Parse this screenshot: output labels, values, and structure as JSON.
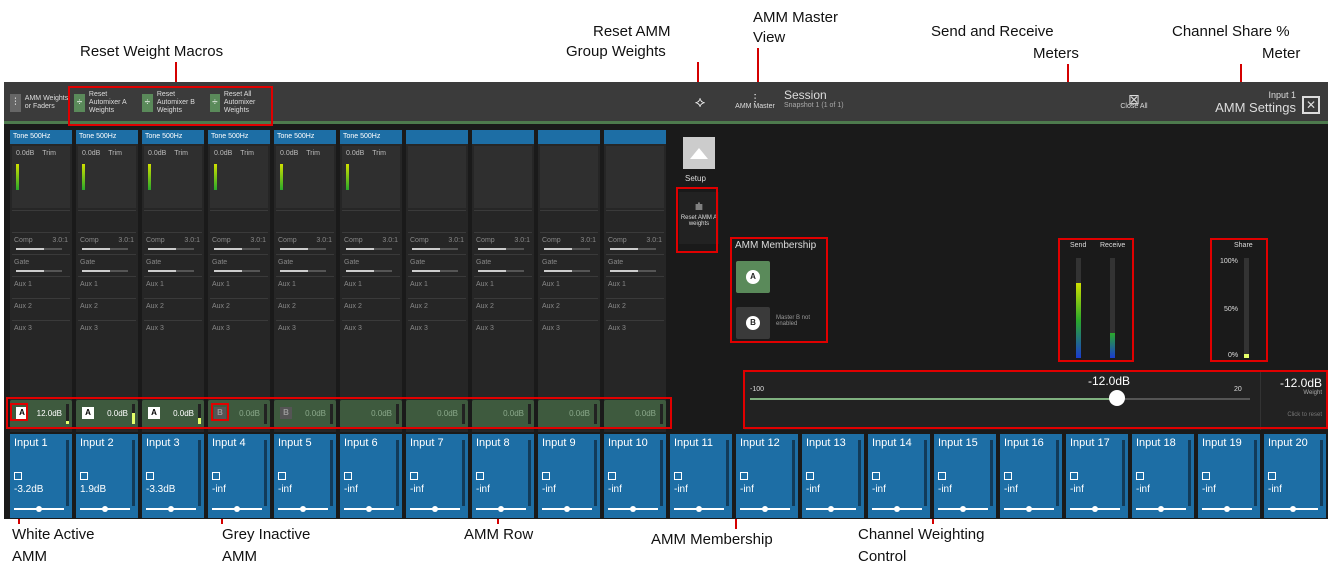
{
  "callouts": {
    "reset_weight_macros": "Reset Weight Macros",
    "reset_amm_group_1": "Reset AMM",
    "reset_amm_group_2": "Group Weights",
    "amm_master_view_1": "AMM Master",
    "amm_master_view_2": "View",
    "send_receive_1": "Send and Receive",
    "send_receive_2": "Meters",
    "share_1": "Channel Share %",
    "share_2": "Meter",
    "white_active_1": "White Active",
    "white_active_2": "AMM",
    "grey_inactive_1": "Grey Inactive",
    "grey_inactive_2": "AMM",
    "amm_row": "AMM Row",
    "amm_membership": "AMM Membership",
    "channel_weighting_1": "Channel Weighting",
    "channel_weighting_2": "Control"
  },
  "topbar": {
    "amm_weights_btn": "AMM Weights or Faders",
    "reset_a": "Reset Automixer A Weights",
    "reset_b": "Reset Automixer B Weights",
    "reset_all": "Reset All Automixer Weights",
    "amm_master": "AMM Master",
    "session_title": "Session",
    "session_snapshot": "Snapshot 1 (1 of 1)",
    "close_all": "Close All",
    "settings_line1": "Input 1",
    "settings_line2": "AMM Settings"
  },
  "strips": [
    {
      "tone": "Tone 500Hz",
      "gain": "0.0dB",
      "trim": "Trim",
      "comp": "Comp",
      "ratio": "3.0:1",
      "gate": "Gate",
      "aux1": "Aux 1",
      "aux2": "Aux 2",
      "aux3": "Aux 3",
      "amm_badge": "A",
      "amm_val": "12.0dB",
      "amm_active": true,
      "amm_level": 0.15,
      "input": "Input 1",
      "input_gain": "-3.2dB"
    },
    {
      "tone": "Tone 500Hz",
      "gain": "0.0dB",
      "trim": "Trim",
      "comp": "Comp",
      "ratio": "3.0:1",
      "gate": "Gate",
      "aux1": "Aux 1",
      "aux2": "Aux 2",
      "aux3": "Aux 3",
      "amm_badge": "A",
      "amm_val": "0.0dB",
      "amm_active": true,
      "amm_level": 0.55,
      "input": "Input 2",
      "input_gain": "1.9dB"
    },
    {
      "tone": "Tone 500Hz",
      "gain": "0.0dB",
      "trim": "Trim",
      "comp": "Comp",
      "ratio": "3.0:1",
      "gate": "Gate",
      "aux1": "Aux 1",
      "aux2": "Aux 2",
      "aux3": "Aux 3",
      "amm_badge": "A",
      "amm_val": "0.0dB",
      "amm_active": true,
      "amm_level": 0.3,
      "input": "Input 3",
      "input_gain": "-3.3dB"
    },
    {
      "tone": "Tone 500Hz",
      "gain": "0.0dB",
      "trim": "Trim",
      "comp": "Comp",
      "ratio": "3.0:1",
      "gate": "Gate",
      "aux1": "Aux 1",
      "aux2": "Aux 2",
      "aux3": "Aux 3",
      "amm_badge": "B",
      "amm_val": "0.0dB",
      "amm_active": false,
      "amm_level": 0,
      "input": "Input 4",
      "input_gain": "-inf"
    },
    {
      "tone": "Tone 500Hz",
      "gain": "0.0dB",
      "trim": "Trim",
      "comp": "Comp",
      "ratio": "3.0:1",
      "gate": "Gate",
      "aux1": "Aux 1",
      "aux2": "Aux 2",
      "aux3": "Aux 3",
      "amm_badge": "B",
      "amm_val": "0.0dB",
      "amm_active": false,
      "amm_level": 0,
      "input": "Input 5",
      "input_gain": "-inf"
    },
    {
      "tone": "Tone 500Hz",
      "gain": "0.0dB",
      "trim": "Trim",
      "comp": "Comp",
      "ratio": "3.0:1",
      "gate": "Gate",
      "aux1": "Aux 1",
      "aux2": "Aux 2",
      "aux3": "Aux 3",
      "amm_badge": "",
      "amm_val": "0.0dB",
      "amm_active": false,
      "amm_level": 0,
      "input": "Input 6",
      "input_gain": "-inf"
    },
    {
      "tone": "",
      "gain": "",
      "trim": "",
      "comp": "Comp",
      "ratio": "3.0:1",
      "gate": "Gate",
      "aux1": "Aux 1",
      "aux2": "Aux 2",
      "aux3": "Aux 3",
      "amm_badge": "",
      "amm_val": "0.0dB",
      "amm_active": false,
      "amm_level": 0,
      "input": "Input 7",
      "input_gain": "-inf"
    },
    {
      "tone": "",
      "gain": "",
      "trim": "",
      "comp": "Comp",
      "ratio": "3.0:1",
      "gate": "Gate",
      "aux1": "Aux 1",
      "aux2": "Aux 2",
      "aux3": "Aux 3",
      "amm_badge": "",
      "amm_val": "0.0dB",
      "amm_active": false,
      "amm_level": 0,
      "input": "Input 8",
      "input_gain": "-inf"
    },
    {
      "tone": "",
      "gain": "",
      "trim": "",
      "comp": "Comp",
      "ratio": "3.0:1",
      "gate": "Gate",
      "aux1": "Aux 1",
      "aux2": "Aux 2",
      "aux3": "Aux 3",
      "amm_badge": "",
      "amm_val": "0.0dB",
      "amm_active": false,
      "amm_level": 0,
      "input": "Input 9",
      "input_gain": "-inf"
    },
    {
      "tone": "",
      "gain": "",
      "trim": "",
      "comp": "Comp",
      "ratio": "3.0:1",
      "gate": "Gate",
      "aux1": "Aux 1",
      "aux2": "Aux 2",
      "aux3": "Aux 3",
      "amm_badge": "",
      "amm_val": "0.0dB",
      "amm_active": false,
      "amm_level": 0,
      "input": "Input 10",
      "input_gain": "-inf"
    }
  ],
  "extra_inputs": [
    {
      "label": "Input 11",
      "gain": "-inf"
    },
    {
      "label": "Input 12",
      "gain": "-inf"
    },
    {
      "label": "Input 13",
      "gain": "-inf"
    },
    {
      "label": "Input 14",
      "gain": "-inf"
    },
    {
      "label": "Input 15",
      "gain": "-inf"
    },
    {
      "label": "Input 16",
      "gain": "-inf"
    },
    {
      "label": "Input 17",
      "gain": "-inf"
    },
    {
      "label": "Input 18",
      "gain": "-inf"
    },
    {
      "label": "Input 19",
      "gain": "-inf"
    },
    {
      "label": "Input 20",
      "gain": "-inf"
    }
  ],
  "center": {
    "setup": "Setup",
    "reset_amm_a": "Reset AMM A weights"
  },
  "membership": {
    "title": "AMM Membership",
    "a_label": "A",
    "b_label": "B",
    "b_note": "Master B not enabled"
  },
  "meters": {
    "send": "Send",
    "receive": "Receive",
    "send_level": 0.75,
    "receive_level": 0.25,
    "share": "Share",
    "share_100": "100%",
    "share_50": "50%",
    "share_0": "0%",
    "share_level": 0.02
  },
  "weighting": {
    "min": "-100",
    "max": "20",
    "value": "-12.0dB",
    "readout": "-12.0dB",
    "readout_label": "Weight",
    "click_reset": "Click to reset",
    "fraction": 0.733
  },
  "colors": {
    "blue": "#1d6ea5",
    "green": "#3e5a3e",
    "accent_red": "#e00000"
  }
}
